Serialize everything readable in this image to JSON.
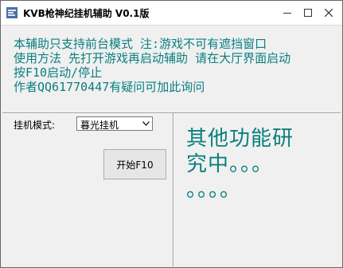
{
  "window": {
    "title": "KVB枪神纪挂机辅助 V0.1版",
    "controls": {
      "minimize": "—",
      "maximize": "☐",
      "close": "✕"
    }
  },
  "info": {
    "lines": [
      "本辅助只支持前台模式 注:游戏不可有遮挡窗口",
      "使用方法 先打开游戏再启动辅助 请在大厅界面启动",
      "按F10启动/停止",
      "作者QQ61770447有疑问可加此询问"
    ]
  },
  "controls": {
    "mode_label": "挂机模式:",
    "mode_selected": "暮光挂机",
    "start_button": "开始F10"
  },
  "other": {
    "text_line1": "其他功能研",
    "text_line2": "究中。。。",
    "text_line3": "。。。。"
  },
  "colors": {
    "info_text": "#0a7f7f",
    "background": "#f0f0f0"
  }
}
